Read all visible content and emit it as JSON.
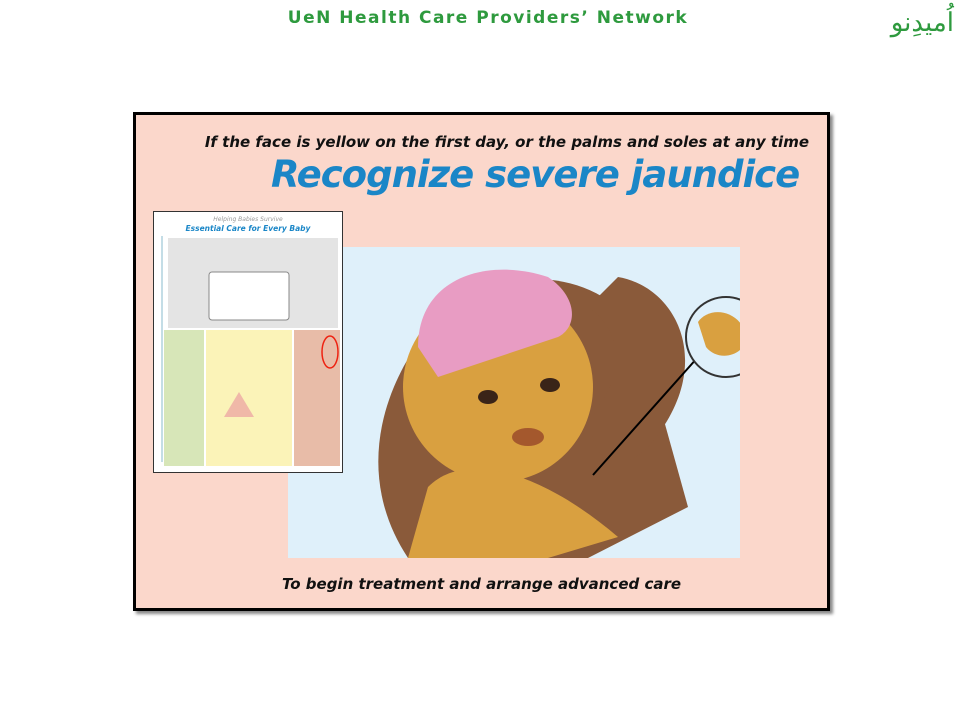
{
  "header": {
    "title": "UeN Health Care Providers’ Network",
    "logo_text": "اُمیدِنو"
  },
  "slide": {
    "subtitle": "If the face is yellow on the first day, or the palms and soles at any time",
    "title": "Recognize severe jaundice",
    "footer": "To begin treatment  and arrange  advanced  care",
    "chart": {
      "series_title": "Helping Babies Survive",
      "title": "Essential Care for Every Baby"
    }
  },
  "colors": {
    "brand_green": "#2e9a3e",
    "title_blue": "#1a86c7",
    "slide_bg": "#fbd7cb"
  }
}
